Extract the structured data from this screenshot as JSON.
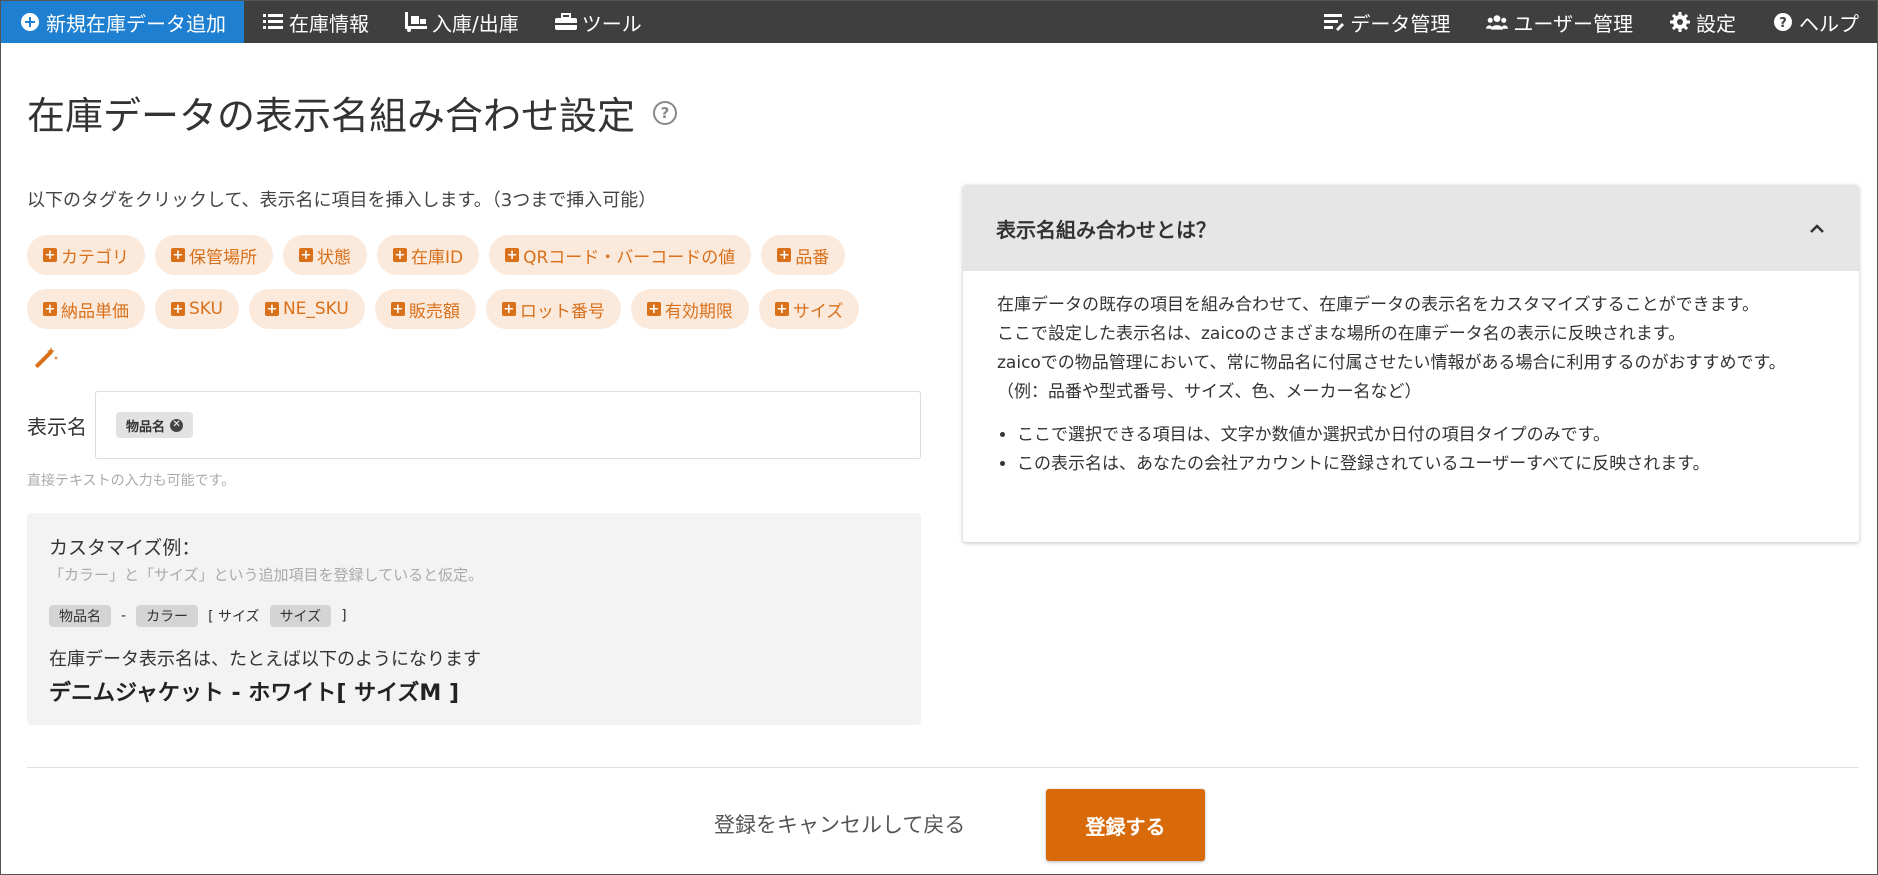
{
  "nav": {
    "left": [
      {
        "label": "新規在庫データ追加",
        "icon": "plus-circle-icon"
      },
      {
        "label": "在庫情報",
        "icon": "list-icon"
      },
      {
        "label": "入庫/出庫",
        "icon": "dolly-icon"
      },
      {
        "label": "ツール",
        "icon": "toolbox-icon"
      }
    ],
    "right": [
      {
        "label": "データ管理",
        "icon": "data-icon"
      },
      {
        "label": "ユーザー管理",
        "icon": "users-icon"
      },
      {
        "label": "設定",
        "icon": "gear-icon"
      },
      {
        "label": "ヘルプ",
        "icon": "question-icon"
      }
    ]
  },
  "page": {
    "title": "在庫データの表示名組み合わせ設定",
    "help_glyph": "?"
  },
  "tags": {
    "instruction": "以下のタグをクリックして、表示名に項目を挿入します。（3つまで挿入可能）",
    "row1": [
      "カテゴリ",
      "保管場所",
      "状態",
      "在庫ID",
      "QRコード・バーコードの値",
      "品番"
    ],
    "row2": [
      "納品単価",
      "SKU",
      "NE_SKU",
      "販売額",
      "ロット番号",
      "有効期限",
      "サイズ"
    ]
  },
  "display_name": {
    "label": "表示名",
    "chip": "物品名",
    "hint": "直接テキストの入力も可能です。"
  },
  "example": {
    "title": "カスタマイズ例：",
    "subtitle": "「カラー」と「サイズ」という追加項目を登録していると仮定。",
    "chip1": "物品名",
    "sep": "-",
    "chip2": "カラー",
    "bracket_open": "[ サイズ",
    "chip3": "サイズ",
    "bracket_close": "]",
    "result_label": "在庫データ表示名は、たとえば以下のようになります",
    "result": "デニムジャケット - ホワイト[ サイズM ]"
  },
  "info": {
    "header": "表示名組み合わせとは？",
    "p1": "在庫データの既存の項目を組み合わせて、在庫データの表示名をカスタマイズすることができます。",
    "p2": "ここで設定した表示名は、zaicoのさまざまな場所の在庫データ名の表示に反映されます。",
    "p3": "zaicoでの物品管理において、常に物品名に付属させたい情報がある場合に利用するのがおすすめです。（例：品番や型式番号、サイズ、色、メーカー名など）",
    "bullets": [
      "ここで選択できる項目は、文字か数値か選択式か日付の項目タイプのみです。",
      "この表示名は、あなたの会社アカウントに登録されているユーザーすべてに反映されます。"
    ]
  },
  "footer": {
    "cancel": "登録をキャンセルして戻る",
    "submit": "登録する"
  },
  "colors": {
    "nav_bg": "#3f3f3f",
    "nav_primary": "#1f7fd0",
    "accent_orange": "#d96a0a",
    "tag_bg": "#fbe9dc"
  }
}
